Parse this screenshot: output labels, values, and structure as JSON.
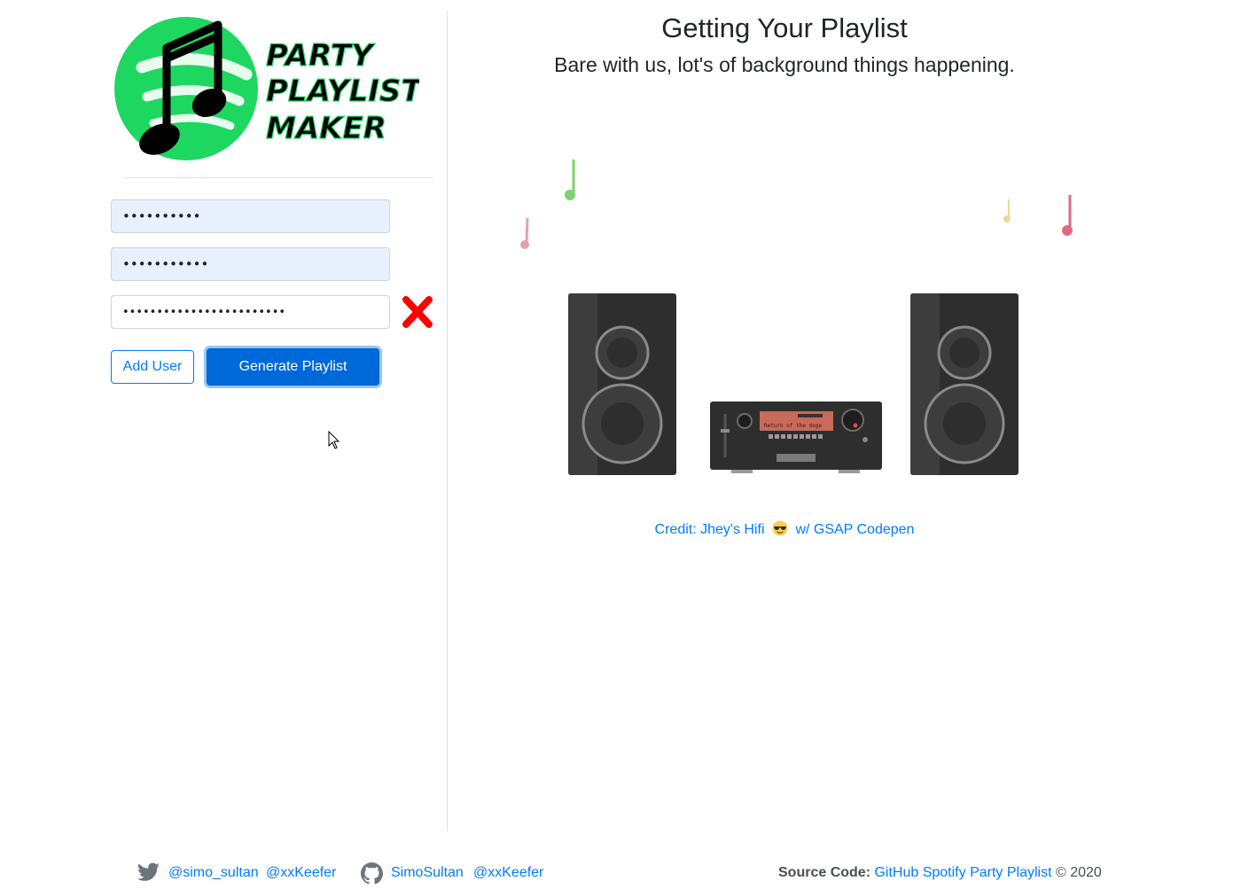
{
  "logo": {
    "line1": "PARTY",
    "line2": "PLAYLIST",
    "line3": "MAKER",
    "brand_color": "#1ed760"
  },
  "inputs": [
    {
      "masked_value": "••••••••••"
    },
    {
      "masked_value": "•••••••••••"
    },
    {
      "masked_value": "••••••••••••••••••••••••"
    }
  ],
  "buttons": {
    "add_user": "Add User",
    "generate": "Generate Playlist"
  },
  "main": {
    "title": "Getting Your Playlist",
    "subtitle": "Bare with us, lot's of background things happening.",
    "display_text": "Return of the doge",
    "credit_prefix": "Credit: Jhey's Hifi",
    "credit_suffix": "w/ GSAP Codepen"
  },
  "footer": {
    "twitter_1": "@simo_sultan",
    "twitter_2": "@xxKeefer",
    "github_1": "SimoSultan",
    "github_2": "@xxKeefer",
    "source_label": "Source Code:",
    "source_link": "GitHub Spotify Party Playlist",
    "copyright": "© 2020"
  },
  "colors": {
    "primary": "#007bff",
    "remove": "#ff0000",
    "note_green": "#7cd36b",
    "note_pink": "#e3a0aa",
    "note_yellow": "#f1d79c",
    "note_rose": "#dc6a87"
  }
}
